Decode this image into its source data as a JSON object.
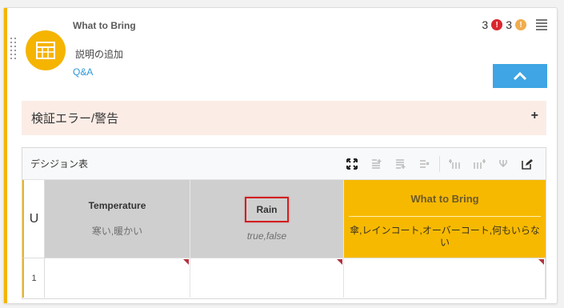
{
  "node": {
    "title": "What to Bring",
    "description_placeholder": "説明の追加",
    "qa_link": "Q&A",
    "error_count": "3",
    "warning_count": "3",
    "colors": {
      "accent": "#f5b400",
      "error": "#d8272d",
      "warning": "#f0ad4e",
      "link": "#2f98d6",
      "collapse": "#3fa5e4"
    }
  },
  "validation": {
    "label": "検証エラー/警告",
    "toggle": "+"
  },
  "decision_table": {
    "label": "デシジョン表",
    "hit_policy": "U",
    "toolbar_icons": [
      "expand-icon",
      "add-rule-above-icon",
      "add-rule-below-icon",
      "delete-rule-icon",
      "add-input-column-icon",
      "add-output-column-icon",
      "merge-icon",
      "edit-icon"
    ],
    "inputs": [
      {
        "name": "Temperature",
        "values": "寒い,暖かい"
      },
      {
        "name": "Rain",
        "values": "true,false"
      }
    ],
    "output": {
      "name": "What to Bring",
      "values": "傘,レインコート,オーバーコート,何もいらない"
    },
    "rows": [
      {
        "number": "1",
        "cells": [
          "",
          "",
          ""
        ]
      }
    ]
  }
}
